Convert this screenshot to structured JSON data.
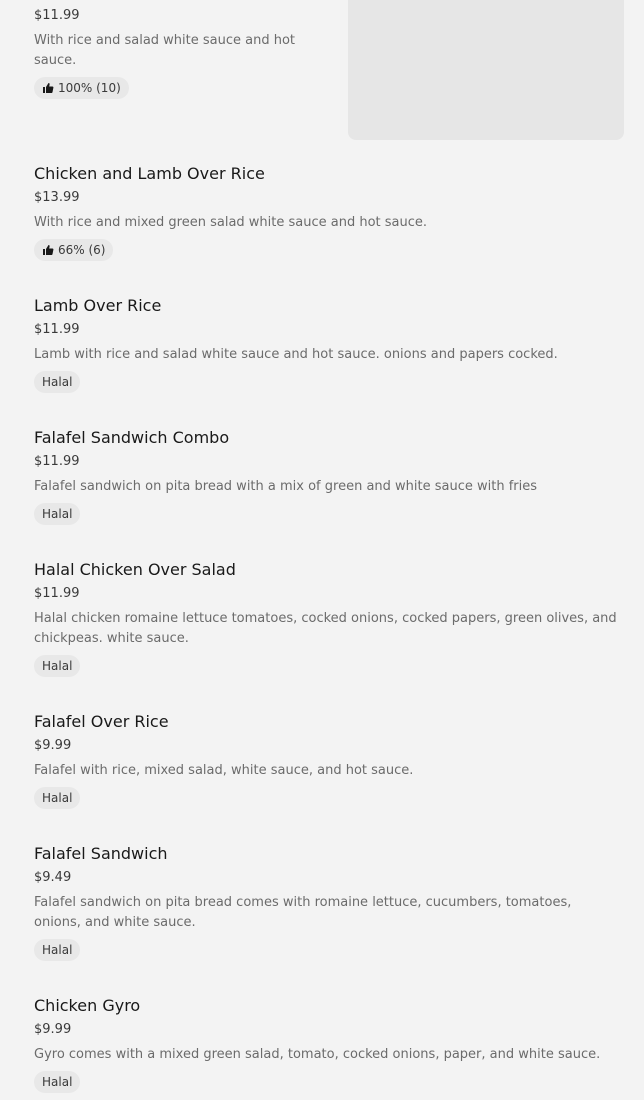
{
  "items": [
    {
      "price": "$11.99",
      "desc": "With rice and salad white sauce and hot sauce.",
      "badge": "100% (10)"
    },
    {
      "name": "Chicken and Lamb Over Rice",
      "price": "$13.99",
      "desc": "With rice and mixed green salad white sauce and hot sauce.",
      "badge": "66% (6)"
    },
    {
      "name": "Lamb Over Rice",
      "price": "$11.99",
      "desc": "Lamb with rice and salad white sauce and hot sauce. onions and papers cocked.",
      "badge": "Halal"
    },
    {
      "name": "Falafel Sandwich Combo",
      "price": "$11.99",
      "desc": "Falafel sandwich on pita bread with a mix of green and white sauce with fries",
      "badge": "Halal"
    },
    {
      "name": "Halal Chicken Over Salad",
      "price": "$11.99",
      "desc": "Halal chicken romaine lettuce tomatoes, cocked onions, cocked papers, green olives, and chickpeas. white sauce.",
      "badge": "Halal"
    },
    {
      "name": "Falafel Over Rice",
      "price": "$9.99",
      "desc": "Falafel with rice, mixed salad, white sauce, and hot sauce.",
      "badge": "Halal"
    },
    {
      "name": "Falafel Sandwich",
      "price": "$9.49",
      "desc": "Falafel sandwich on pita bread comes with romaine lettuce, cucumbers, tomatoes, onions, and white sauce.",
      "badge": "Halal"
    },
    {
      "name": "Chicken Gyro",
      "price": "$9.99",
      "desc": "Gyro comes with a mixed green salad, tomato, cocked onions, paper, and white sauce.",
      "badge": "Halal"
    }
  ]
}
